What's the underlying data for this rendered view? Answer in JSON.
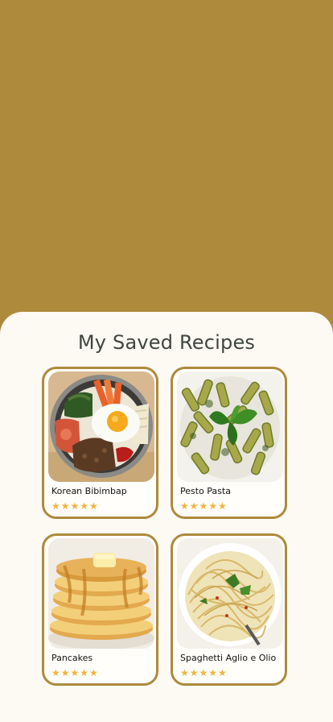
{
  "header": {
    "title": "My Saved Recipes"
  },
  "recipes": [
    {
      "name": "Korean Bibimbap",
      "rating": 4.5,
      "image": "bibimbap-photo",
      "stars": "★★★★★"
    },
    {
      "name": "Pesto Pasta",
      "rating": 5,
      "image": "pesto-pasta-photo",
      "stars": "★★★★★"
    },
    {
      "name": "Pancakes",
      "rating": 5,
      "image": "pancakes-photo",
      "stars": "★★★★★"
    },
    {
      "name": "Spaghetti Aglio e Olio",
      "rating": 5,
      "image": "spaghetti-photo",
      "stars": "★★★★★"
    }
  ],
  "colors": {
    "background": "#ad8a3c",
    "sheet": "#fdf9f3",
    "accent": "#ad8a3c",
    "star": "#f4b23a",
    "title": "#3f453f"
  }
}
